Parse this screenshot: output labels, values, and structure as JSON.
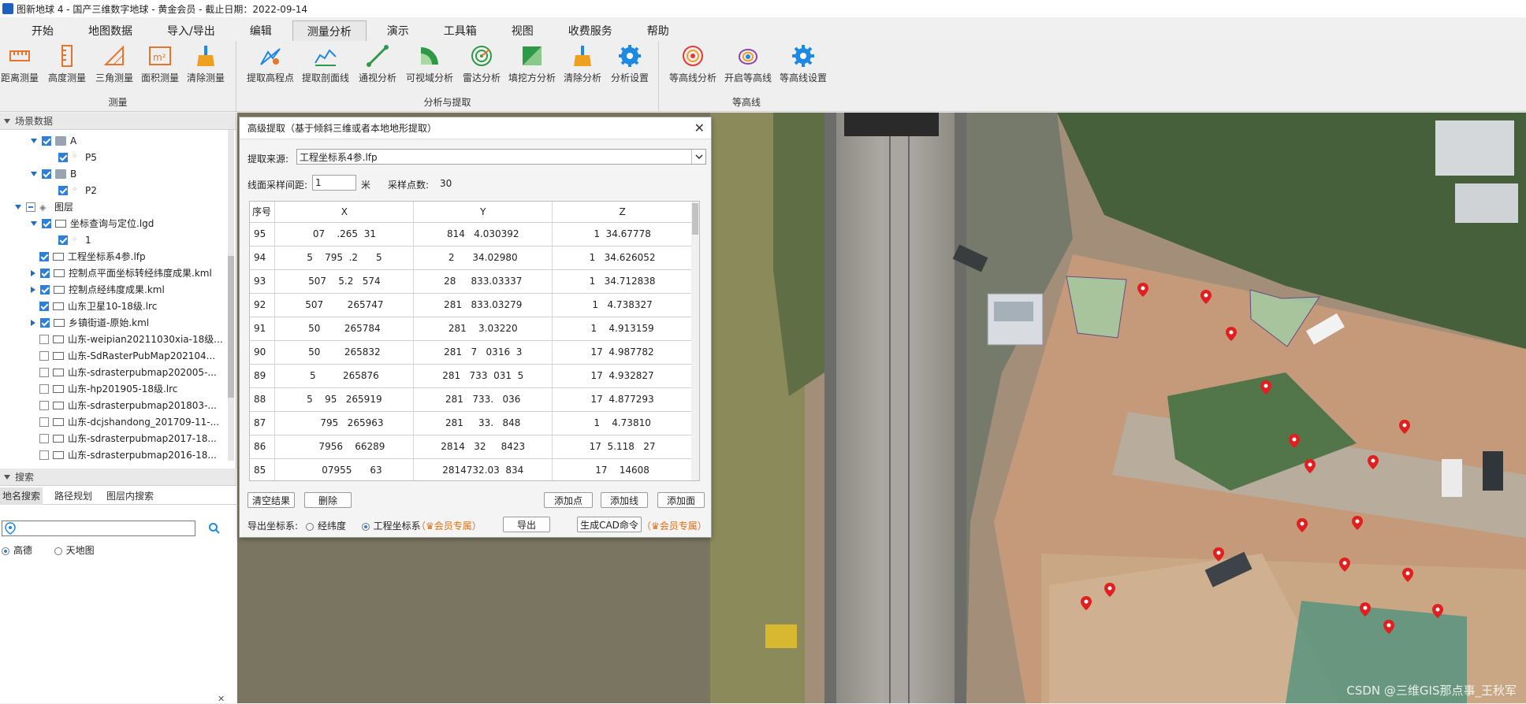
{
  "window": {
    "title": "图新地球 4 - 国产三维数字地球 - 黄金会员 - 截止日期：2022-09-14"
  },
  "menu": {
    "tabs": [
      "开始",
      "地图数据",
      "导入/导出",
      "编辑",
      "测量分析",
      "演示",
      "工具箱",
      "视图",
      "收费服务",
      "帮助"
    ],
    "active": "测量分析"
  },
  "ribbon": {
    "groups": [
      {
        "label": "测量",
        "buttons": [
          "距离测量",
          "高度测量",
          "三角测量",
          "面积测量",
          "清除测量"
        ]
      },
      {
        "label": "分析与提取",
        "buttons": [
          "提取高程点",
          "提取剖面线",
          "通视分析",
          "可视域分析",
          "雷达分析",
          "填挖方分析",
          "清除分析",
          "分析设置"
        ]
      },
      {
        "label": "等高线",
        "buttons": [
          "等高线分析",
          "开启等高线",
          "等高线设置"
        ]
      }
    ],
    "colors": {
      "accent_orange": "#e8742a",
      "accent_blue": "#1e88e5",
      "accent_green": "#2e9a48"
    }
  },
  "scene_panel": {
    "title": "场景数据",
    "tree": [
      {
        "label": "A",
        "level": 1,
        "type": "folder",
        "checked": "on",
        "expanded": true
      },
      {
        "label": "P5",
        "level": 2,
        "type": "points",
        "checked": "on"
      },
      {
        "label": "B",
        "level": 1,
        "type": "folder",
        "checked": "on",
        "expanded": true
      },
      {
        "label": "P2",
        "level": 2,
        "type": "points",
        "checked": "on"
      },
      {
        "label": "图层",
        "level": 0,
        "type": "layers",
        "checked": "part",
        "expanded": true
      },
      {
        "label": "坐标查询与定位.lgd",
        "level": 1,
        "type": "layer",
        "checked": "on",
        "expanded": true
      },
      {
        "label": "1",
        "level": 2,
        "type": "points",
        "checked": "on"
      },
      {
        "label": "工程坐标系4参.lfp",
        "level": 1,
        "type": "layer",
        "checked": "on"
      },
      {
        "label": "控制点平面坐标转经纬度成果.kml",
        "level": 1,
        "type": "layer",
        "checked": "on",
        "collapsed": true
      },
      {
        "label": "控制点经纬度成果.kml",
        "level": 1,
        "type": "layer",
        "checked": "on",
        "collapsed": true
      },
      {
        "label": "山东卫星10-18级.lrc",
        "level": 1,
        "type": "layer",
        "checked": "on"
      },
      {
        "label": "乡镇街道-原始.kml",
        "level": 1,
        "type": "layer",
        "checked": "on",
        "collapsed": true
      },
      {
        "label": "山东-weipian20211030xia-18级...",
        "level": 1,
        "type": "layer",
        "checked": "off"
      },
      {
        "label": "山东-SdRasterPubMap202104...",
        "level": 1,
        "type": "layer",
        "checked": "off"
      },
      {
        "label": "山东-sdrasterpubmap202005-...",
        "level": 1,
        "type": "layer",
        "checked": "off"
      },
      {
        "label": "山东-hp201905-18级.lrc",
        "level": 1,
        "type": "layer",
        "checked": "off"
      },
      {
        "label": "山东-sdrasterpubmap201803-...",
        "level": 1,
        "type": "layer",
        "checked": "off"
      },
      {
        "label": "山东-dcjshandong_201709-11-...",
        "level": 1,
        "type": "layer",
        "checked": "off"
      },
      {
        "label": "山东-sdrasterpubmap2017-18...",
        "level": 1,
        "type": "layer",
        "checked": "off"
      },
      {
        "label": "山东-sdrasterpubmap2016-18...",
        "level": 1,
        "type": "layer",
        "checked": "off"
      }
    ]
  },
  "search_panel": {
    "title": "搜索",
    "tabs": [
      "地名搜索",
      "路径规划",
      "图层内搜索"
    ],
    "active_tab": "地名搜索",
    "input_value": "",
    "providers": [
      "高德",
      "天地图"
    ],
    "selected_provider": "高德"
  },
  "dialog": {
    "title": "高级提取（基于倾斜三维或者本地地形提取）",
    "source_label": "提取来源:",
    "source_value": "工程坐标系4参.lfp",
    "interval_label": "线面采样间距:",
    "interval_value": "1",
    "interval_unit": "米",
    "count_label": "采样点数:",
    "count_value": "30",
    "columns": [
      "序号",
      "X",
      "Y",
      "Z"
    ],
    "rows": [
      {
        "seq": "95",
        "x": "07    .265  31",
        "y": "814   4.030392",
        "z": "1  34.67778"
      },
      {
        "seq": "94",
        "x": "5    795  .2      5",
        "y": "2      34.02980",
        "z": "1   34.626052"
      },
      {
        "seq": "93",
        "x": "507    5.2   574",
        "y": "28     833.03337",
        "z": "1   34.712838"
      },
      {
        "seq": "92",
        "x": "507        265747",
        "y": "281   833.03279",
        "z": "1   4.738327"
      },
      {
        "seq": "91",
        "x": "50        265784",
        "y": "281    3.03220",
        "z": "1    4.913159"
      },
      {
        "seq": "90",
        "x": "50        265832",
        "y": "281   7   0316  3",
        "z": "17  4.987782"
      },
      {
        "seq": "89",
        "x": "5         265876",
        "y": "281   733  031  5",
        "z": "17  4.932827"
      },
      {
        "seq": "88",
        "x": "5    95   265919",
        "y": "281   733.   036",
        "z": "17  4.877293"
      },
      {
        "seq": "87",
        "x": "     795   265963",
        "y": "281     33.   848",
        "z": "1    4.73810"
      },
      {
        "seq": "86",
        "x": "     7956    66289",
        "y": "2814   32     8423",
        "z": "17  5.118   27"
      },
      {
        "seq": "85",
        "x": "     07955      63",
        "y": "2814732.03  834",
        "z": "17    14608"
      }
    ],
    "buttons": {
      "clear": "清空结果",
      "delete": "删除",
      "add_point": "添加点",
      "add_line": "添加线",
      "add_area": "添加面",
      "export": "导出",
      "gen_cad": "生成CAD命令"
    },
    "export_label": "导出坐标系:",
    "coord_options": [
      "经纬度",
      "工程坐标系"
    ],
    "selected_coord": "工程坐标系",
    "vip_label": "会员专属"
  },
  "watermark": "CSDN @三维GIS那点事_王秋军"
}
